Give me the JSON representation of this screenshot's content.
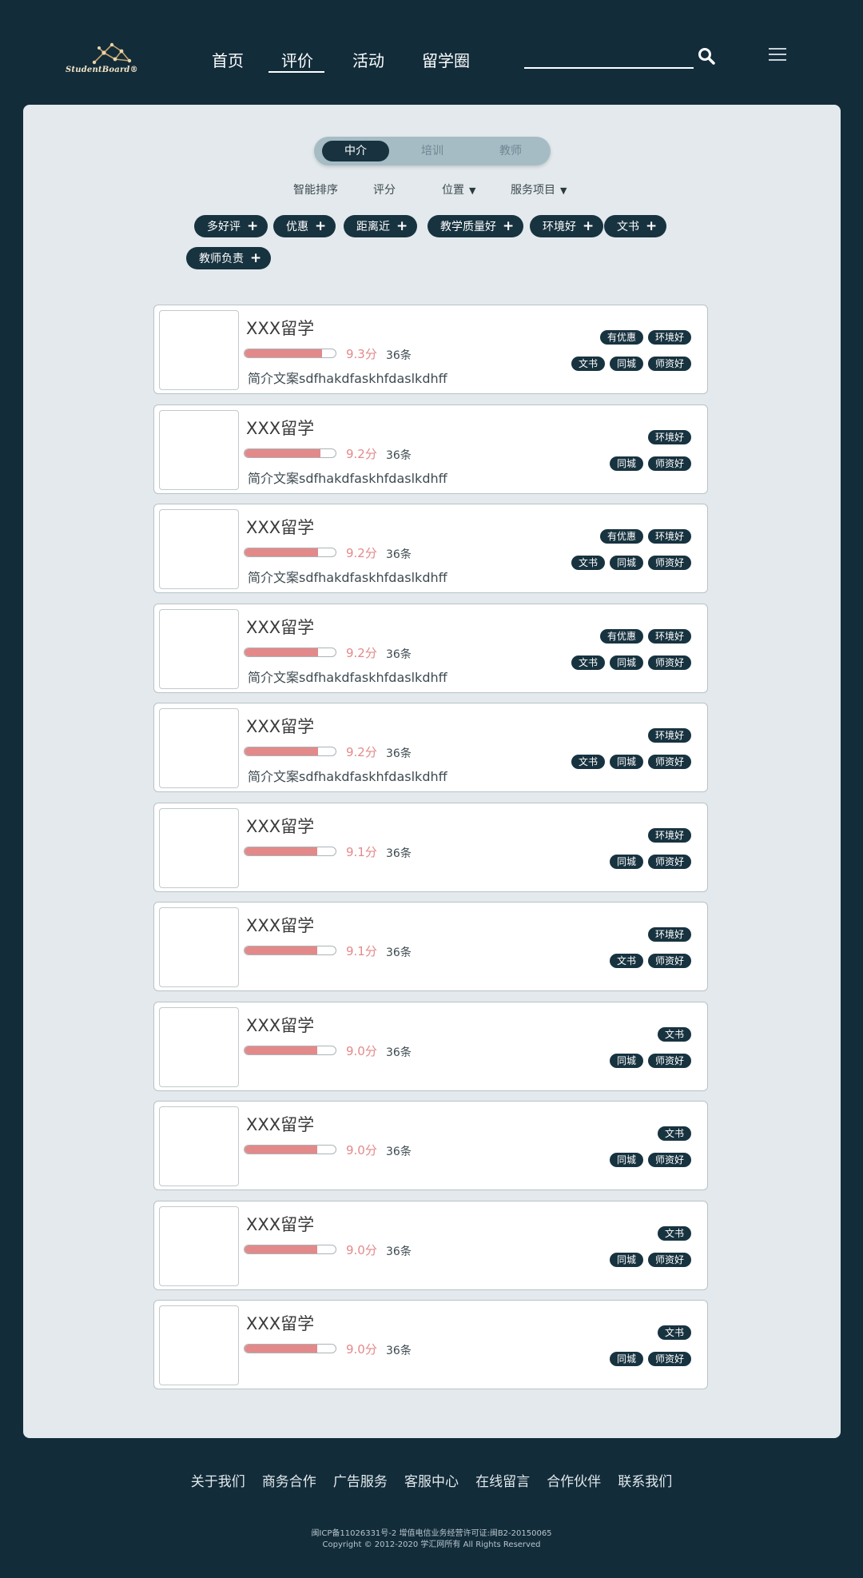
{
  "header": {
    "logo_text": "StudentBoard®",
    "nav": [
      {
        "label": "首页",
        "active": false
      },
      {
        "label": "评价",
        "active": true
      },
      {
        "label": "活动",
        "active": false
      },
      {
        "label": "留学圈",
        "active": false
      }
    ],
    "search_placeholder": "",
    "search_icon": "search-icon",
    "menu_icon": "hamburger-menu-icon"
  },
  "filter": {
    "segments": [
      {
        "label": "中介",
        "active": true
      },
      {
        "label": "培训",
        "active": false
      },
      {
        "label": "教师",
        "active": false
      }
    ],
    "sort_options": [
      {
        "label": "智能排序",
        "dropdown": false
      },
      {
        "label": "评分",
        "dropdown": false
      },
      {
        "label": "位置",
        "dropdown": true
      },
      {
        "label": "服务项目",
        "dropdown": true
      }
    ],
    "dropdown_glyph": "▼",
    "chips": [
      "多好评",
      "优惠",
      "距离近",
      "教学质量好",
      "环境好",
      "文书",
      "教师负责"
    ],
    "chip_plus": "+"
  },
  "listings": [
    {
      "title": "XXX留学",
      "rating": 0.85,
      "score": "9.3分",
      "count": "36条",
      "desc": "简介文案sdfhakdfaskhfdaslkdhff",
      "tags_top": [
        "有优惠",
        "环境好"
      ],
      "tags_bottom": [
        "文书",
        "同城",
        "师资好"
      ]
    },
    {
      "title": "XXX留学",
      "rating": 0.83,
      "score": "9.2分",
      "count": "36条",
      "desc": "简介文案sdfhakdfaskhfdaslkdhff",
      "tags_top": [
        "环境好"
      ],
      "tags_bottom": [
        "同城",
        "师资好"
      ]
    },
    {
      "title": "XXX留学",
      "rating": 0.81,
      "score": "9.2分",
      "count": "36条",
      "desc": "简介文案sdfhakdfaskhfdaslkdhff",
      "tags_top": [
        "有优惠",
        "环境好"
      ],
      "tags_bottom": [
        "文书",
        "同城",
        "师资好"
      ]
    },
    {
      "title": "XXX留学",
      "rating": 0.81,
      "score": "9.2分",
      "count": "36条",
      "desc": "简介文案sdfhakdfaskhfdaslkdhff",
      "tags_top": [
        "有优惠",
        "环境好"
      ],
      "tags_bottom": [
        "文书",
        "同城",
        "师资好"
      ]
    },
    {
      "title": "XXX留学",
      "rating": 0.81,
      "score": "9.2分",
      "count": "36条",
      "desc": "简介文案sdfhakdfaskhfdaslkdhff",
      "tags_top": [
        "环境好"
      ],
      "tags_bottom": [
        "文书",
        "同城",
        "师资好"
      ]
    },
    {
      "title": "XXX留学",
      "rating": 0.8,
      "score": "9.1分",
      "count": "36条",
      "desc": "",
      "tags_top": [
        "环境好"
      ],
      "tags_bottom": [
        "同城",
        "师资好"
      ]
    },
    {
      "title": "XXX留学",
      "rating": 0.8,
      "score": "9.1分",
      "count": "36条",
      "desc": "",
      "tags_top": [
        "环境好"
      ],
      "tags_bottom": [
        "文书",
        "师资好"
      ]
    },
    {
      "title": "XXX留学",
      "rating": 0.8,
      "score": "9.0分",
      "count": "36条",
      "desc": "",
      "tags_top": [
        "文书"
      ],
      "tags_bottom": [
        "同城",
        "师资好"
      ]
    },
    {
      "title": "XXX留学",
      "rating": 0.8,
      "score": "9.0分",
      "count": "36条",
      "desc": "",
      "tags_top": [
        "文书"
      ],
      "tags_bottom": [
        "同城",
        "师资好"
      ]
    },
    {
      "title": "XXX留学",
      "rating": 0.8,
      "score": "9.0分",
      "count": "36条",
      "desc": "",
      "tags_top": [
        "文书"
      ],
      "tags_bottom": [
        "同城",
        "师资好"
      ]
    },
    {
      "title": "XXX留学",
      "rating": 0.8,
      "score": "9.0分",
      "count": "36条",
      "desc": "",
      "tags_top": [
        "文书"
      ],
      "tags_bottom": [
        "同城",
        "师资好"
      ]
    }
  ],
  "footer": {
    "links": [
      "关于我们",
      "商务合作",
      "广告服务",
      "客服中心",
      "在线留言",
      "合作伙伴",
      "联系我们"
    ],
    "icp": "闽ICP备11026331号-2 增值电信业务经营许可证:闽B2-20150065",
    "copyright": "Copyright © 2012-2020 学汇网所有 All Rights Reserved"
  },
  "colors": {
    "background": "#122c3a",
    "panel": "#e3e9ec",
    "dark_accent": "#183340",
    "score_pink": "#e3898a"
  }
}
